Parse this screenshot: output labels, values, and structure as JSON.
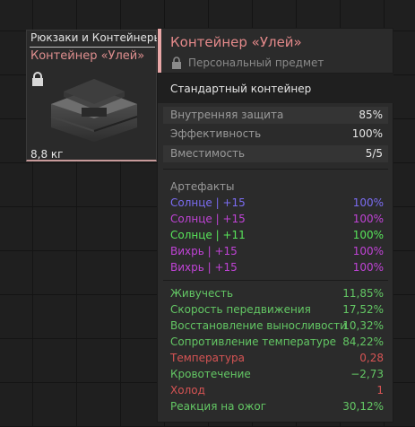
{
  "item": {
    "category": "Рюкзаки и Контейнеры",
    "name": "Контейнер «Улей»",
    "weight": "8,8 кг"
  },
  "tooltip": {
    "title": "Контейнер «Улей»",
    "subtitle": "Персональный предмет",
    "type": "Стандартный контейнер",
    "stats": [
      {
        "label": "Внутренняя защита",
        "value": "85%"
      },
      {
        "label": "Эффективность",
        "value": "100%"
      },
      {
        "label": "Вместимость",
        "value": "5/5"
      }
    ],
    "artifacts_header": "Артефакты",
    "artifacts": [
      {
        "name": "Солнце | +15",
        "value": "100%",
        "color": "#7b6cf2"
      },
      {
        "name": "Солнце | +15",
        "value": "100%",
        "color": "#c043d6"
      },
      {
        "name": "Солнце | +11",
        "value": "100%",
        "color": "#58e45a"
      },
      {
        "name": "Вихрь | +15",
        "value": "100%",
        "color": "#c043d6"
      },
      {
        "name": "Вихрь | +15",
        "value": "100%",
        "color": "#c043d6"
      }
    ],
    "effects": [
      {
        "name": "Живучесть",
        "value": "11,85%",
        "color": "#63c764"
      },
      {
        "name": "Скорость передвижения",
        "value": "17,52%",
        "color": "#63c764"
      },
      {
        "name": "Восстановление выносливости",
        "value": "10,32%",
        "color": "#63c764"
      },
      {
        "name": "Сопротивление температуре",
        "value": "84,22%",
        "color": "#63c764"
      },
      {
        "name": "Температура",
        "value": "0,28",
        "color": "#d65454"
      },
      {
        "name": "Кровотечение",
        "value": "−2,73",
        "color": "#63c764"
      },
      {
        "name": "Холод",
        "value": "1",
        "color": "#d65454"
      },
      {
        "name": "Реакция на ожог",
        "value": "30,12%",
        "color": "#63c764"
      }
    ]
  },
  "colors": {
    "accent": "#e9a7a7",
    "title": "#e4898a",
    "positive": "#63c764",
    "negative": "#d65454"
  }
}
